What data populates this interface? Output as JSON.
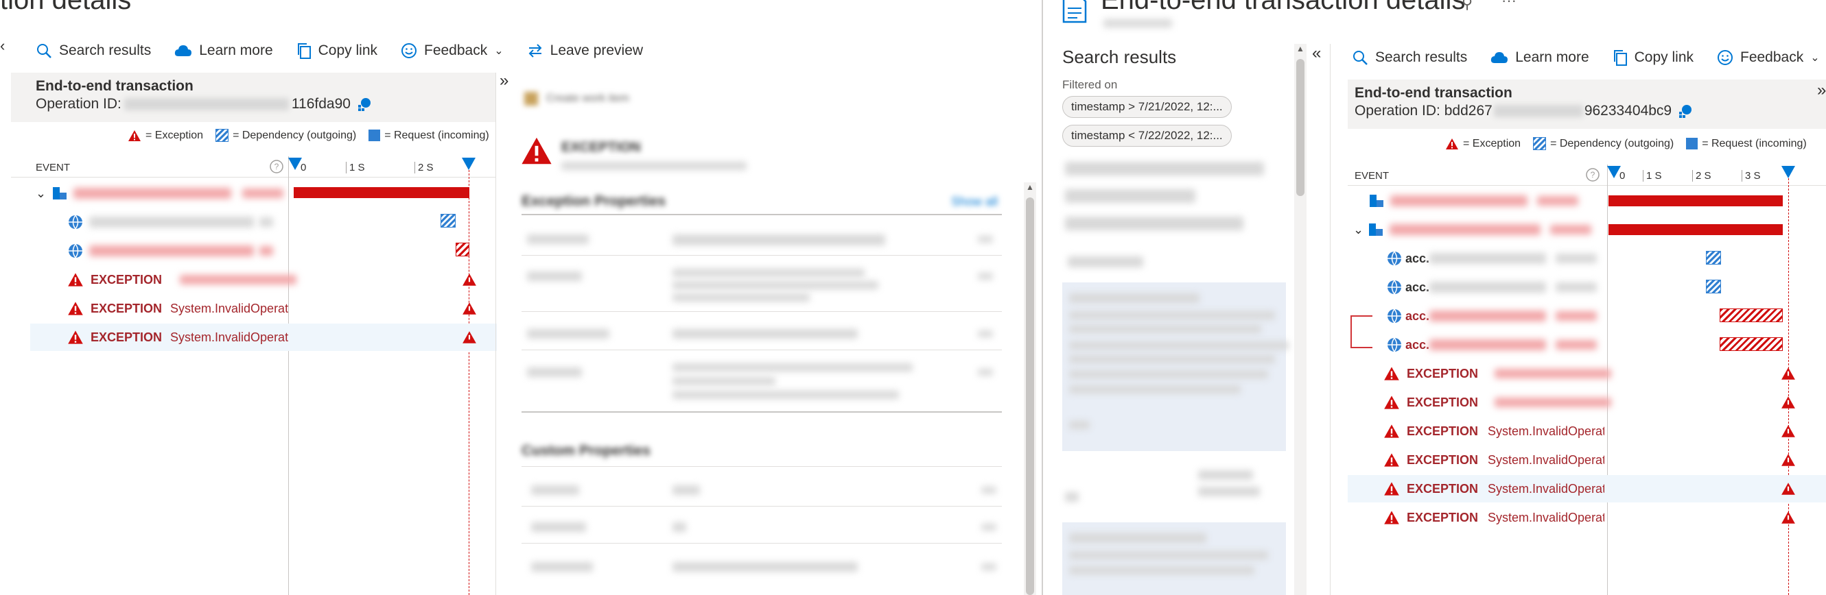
{
  "left": {
    "title": "tion details",
    "toolbar": {
      "search": "Search results",
      "learn": "Learn more",
      "copy": "Copy link",
      "feedback": "Feedback",
      "leave": "Leave preview"
    },
    "header": {
      "title": "End-to-end transaction",
      "op_label": "Operation ID:",
      "op_suffix": "116fda90"
    },
    "legend": {
      "exception": "= Exception",
      "dependency": "= Dependency (outgoing)",
      "request": "= Request (incoming)"
    },
    "timeline": {
      "event_label": "EVENT",
      "ticks": [
        "0",
        "1 S",
        "2 S"
      ]
    },
    "rows": [
      {
        "kind": "request"
      },
      {
        "kind": "dependency"
      },
      {
        "kind": "dependency"
      },
      {
        "kind": "exception",
        "label": "EXCEPTION",
        "type": ""
      },
      {
        "kind": "exception",
        "label": "EXCEPTION",
        "type": "System.InvalidOperati"
      },
      {
        "kind": "exception",
        "label": "EXCEPTION",
        "type": "System.InvalidOperati"
      }
    ],
    "detail": {
      "create_work_item": "Create work item",
      "section_title": "EXCEPTION",
      "props_title": "Exception Properties",
      "show_all": "Show all",
      "custom_title": "Custom Properties"
    }
  },
  "right": {
    "title": "End-to-end transaction details",
    "search": {
      "title": "Search results",
      "filtered_on": "Filtered on",
      "filters": [
        "timestamp > 7/21/2022, 12:...",
        "timestamp < 7/22/2022, 12:..."
      ]
    },
    "toolbar": {
      "search": "Search results",
      "learn": "Learn more",
      "copy": "Copy link",
      "feedback": "Feedback"
    },
    "header": {
      "title": "End-to-end transaction",
      "op_label": "Operation ID: bdd267",
      "op_suffix": "96233404bc9"
    },
    "legend": {
      "exception": "= Exception",
      "dependency": "= Dependency (outgoing)",
      "request": "= Request (incoming)"
    },
    "timeline": {
      "event_label": "EVENT",
      "ticks": [
        "0",
        "1 S",
        "2 S",
        "3 S"
      ]
    },
    "rows": [
      {
        "kind": "request"
      },
      {
        "kind": "request"
      },
      {
        "kind": "dependency",
        "label": "acc."
      },
      {
        "kind": "dependency",
        "label": "acc."
      },
      {
        "kind": "dependency",
        "label": "acc."
      },
      {
        "kind": "dependency",
        "label": "acc."
      },
      {
        "kind": "exception",
        "label": "EXCEPTION",
        "type": ""
      },
      {
        "kind": "exception",
        "label": "EXCEPTION",
        "type": ""
      },
      {
        "kind": "exception",
        "label": "EXCEPTION",
        "type": "System.InvalidOperati"
      },
      {
        "kind": "exception",
        "label": "EXCEPTION",
        "type": "System.InvalidOperati"
      },
      {
        "kind": "exception",
        "label": "EXCEPTION",
        "type": "System.InvalidOperati"
      },
      {
        "kind": "exception",
        "label": "EXCEPTION",
        "type": "System.InvalidOperati"
      }
    ]
  },
  "colors": {
    "accent": "#0078d4",
    "error": "#d10e0e",
    "error_text": "#a4262c",
    "selected": "#eff6fc"
  }
}
